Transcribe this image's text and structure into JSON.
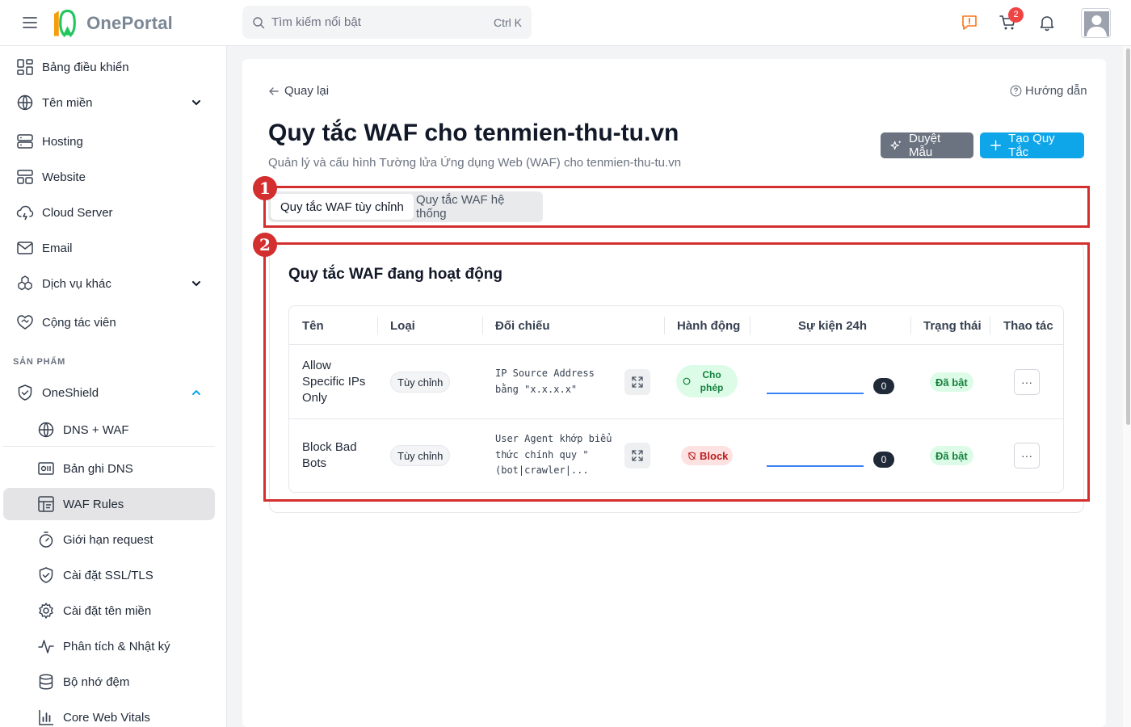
{
  "header": {
    "logo_text": "OnePortal",
    "search_placeholder": "Tìm kiếm nổi bật",
    "search_shortcut": "Ctrl K",
    "cart_count": "2",
    "accent_color": "#0ea5e9"
  },
  "sidebar": {
    "items": [
      {
        "label": "Bảng điều khiển",
        "icon": "dashboard-icon"
      },
      {
        "label": "Tên miền",
        "icon": "globe-icon"
      },
      {
        "label": "Hosting",
        "icon": "server-icon"
      },
      {
        "label": "Website",
        "icon": "layout-icon"
      },
      {
        "label": "Cloud Server",
        "icon": "cloud-icon"
      },
      {
        "label": "Email",
        "icon": "mail-icon"
      },
      {
        "label": "Dịch vụ khác",
        "icon": "boxes-icon"
      },
      {
        "label": "Cộng tác viên",
        "icon": "handshake-heart-icon"
      }
    ],
    "section_label": "SẢN PHẨM",
    "product": {
      "label": "OneShield",
      "icon": "shield-icon"
    },
    "sub_items": [
      {
        "label": "DNS + WAF",
        "icon": "globe-icon"
      },
      {
        "label": "Bản ghi DNS",
        "icon": "dns-record-icon"
      },
      {
        "label": "WAF Rules",
        "icon": "waf-rules-icon",
        "active": true
      },
      {
        "label": "Giới hạn request",
        "icon": "timer-icon"
      },
      {
        "label": "Cài đặt SSL/TLS",
        "icon": "shield-check-icon"
      },
      {
        "label": "Cài đặt tên miền",
        "icon": "gear-icon"
      },
      {
        "label": "Phân tích & Nhật ký",
        "icon": "activity-icon"
      },
      {
        "label": "Bộ nhớ đệm",
        "icon": "database-icon"
      },
      {
        "label": "Core Web Vitals",
        "icon": "bar-chart-icon"
      }
    ]
  },
  "page": {
    "back_label": "Quay lại",
    "help_label": "Hướng dẫn",
    "title": "Quy tắc WAF cho tenmien-thu-tu.vn",
    "subtitle": "Quản lý và cấu hình Tường lửa Ứng dụng Web (WAF) cho tenmien-thu-tu.vn",
    "btn_template": "Duyệt Mẫu",
    "btn_create": "Tạo Quy Tắc",
    "tabs": [
      "Quy tắc WAF tùy chỉnh",
      "Quy tắc WAF hệ thống"
    ],
    "annotations": [
      "1",
      "2"
    ]
  },
  "rules_card": {
    "title": "Quy tắc WAF đang hoạt động",
    "columns": [
      "Tên",
      "Loại",
      "Đối chiếu",
      "Hành động",
      "Sự kiện 24h",
      "Trạng thái",
      "Thao tác"
    ],
    "rows": [
      {
        "name": "Allow Specific IPs Only",
        "type": "Tùy chỉnh",
        "match": "IP Source Address bằng \"x.x.x.x\"",
        "action": "Cho phép",
        "events": "0",
        "status": "Đã bật",
        "more": "···"
      },
      {
        "name": "Block Bad Bots",
        "type": "Tùy chỉnh",
        "match": "User Agent khớp biểu thức chính quy \"(bot|crawler|...",
        "action": "Block",
        "events": "0",
        "status": "Đã bật",
        "more": "···"
      }
    ]
  }
}
